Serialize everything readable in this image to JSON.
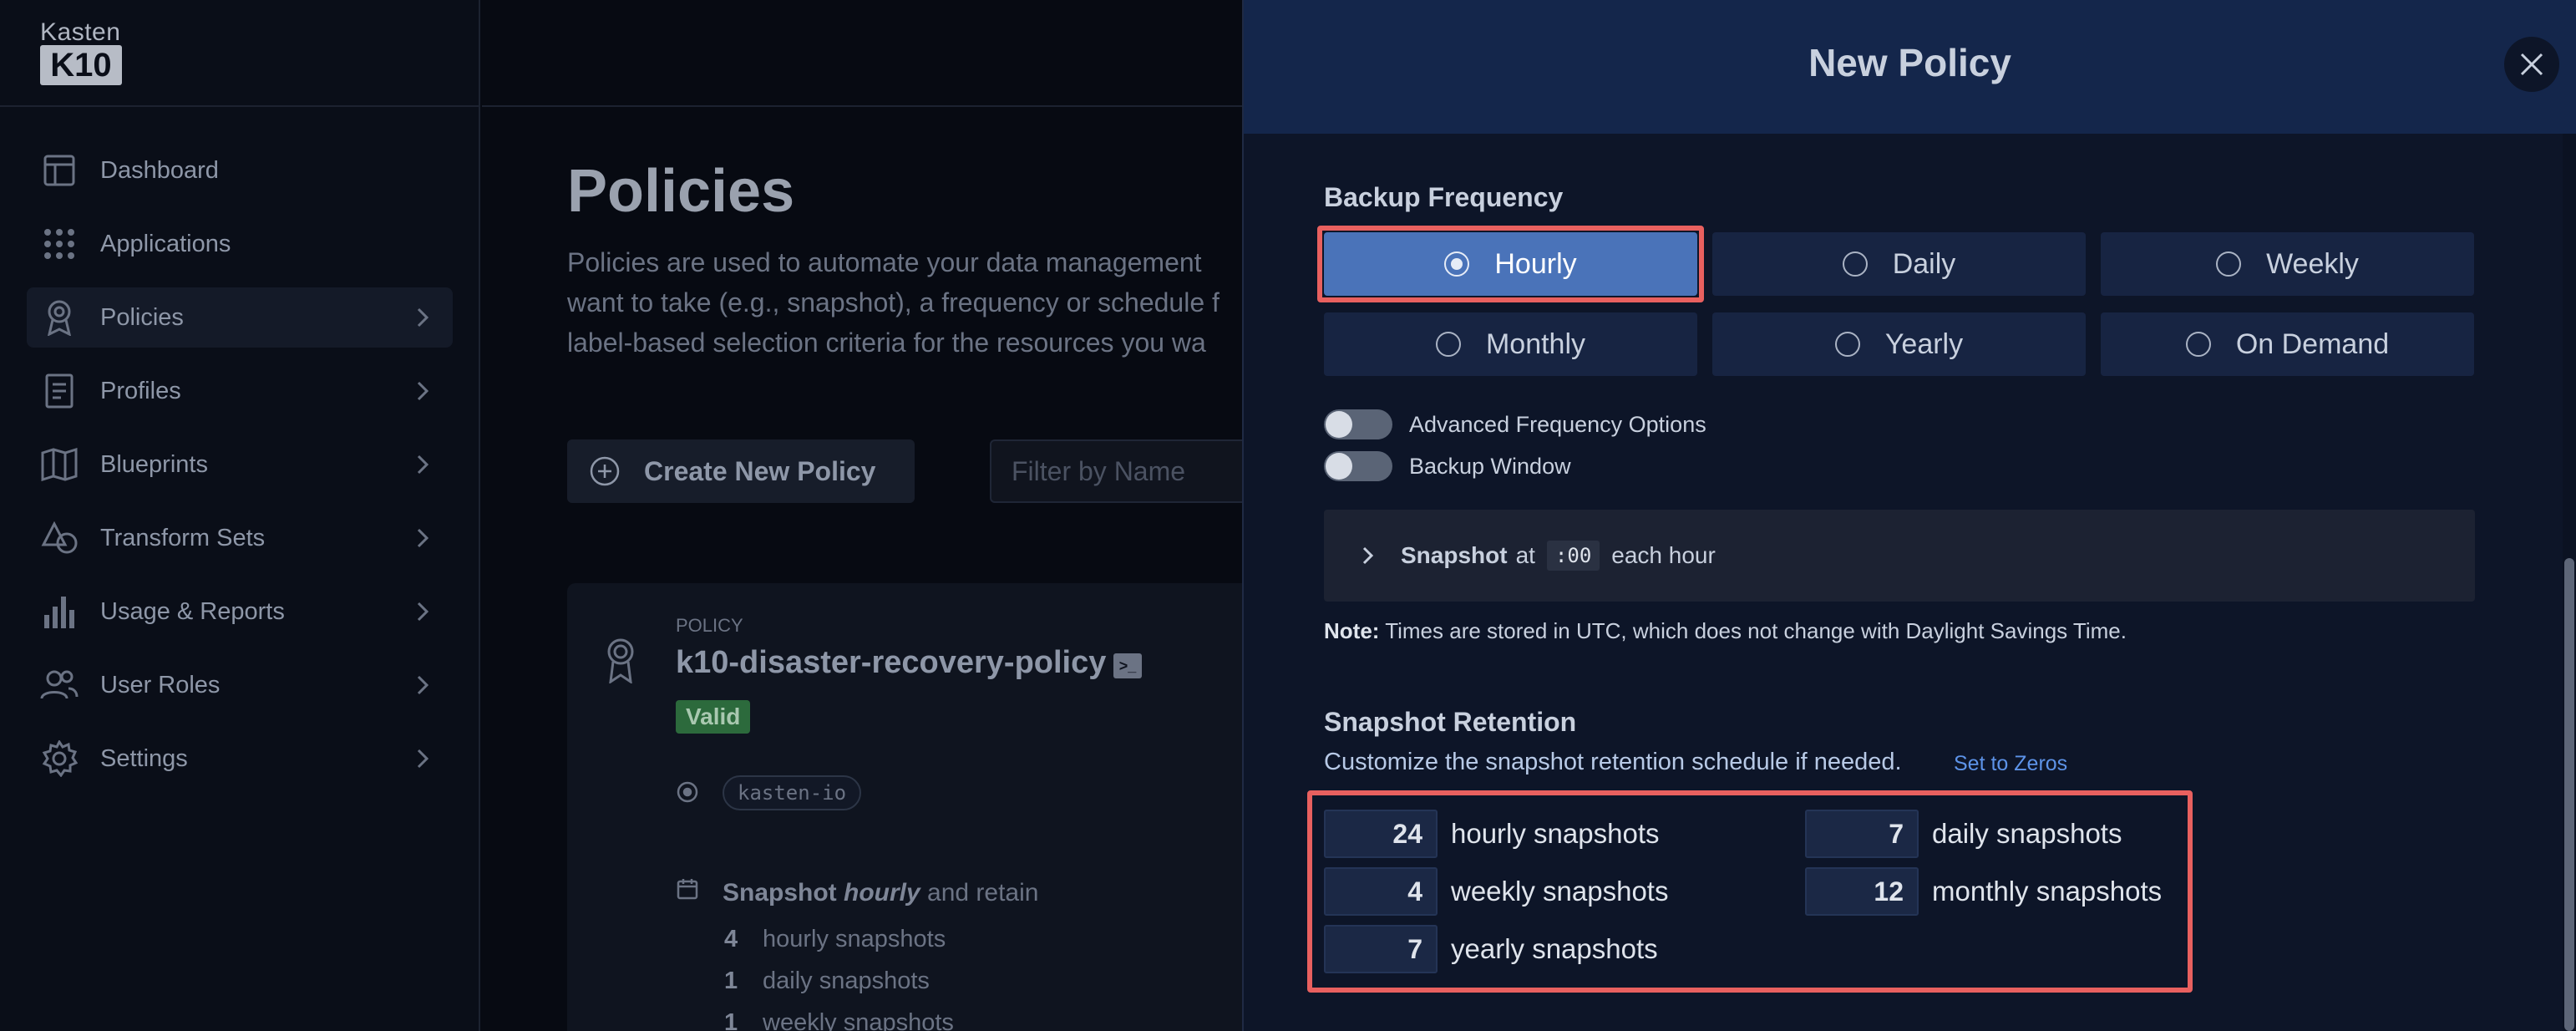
{
  "brand": {
    "top": "Kasten",
    "mark": "K10"
  },
  "sidebar": {
    "items": [
      {
        "label": "Dashboard",
        "icon": "dashboard-icon",
        "chevron": false
      },
      {
        "label": "Applications",
        "icon": "applications-grid-icon",
        "chevron": false
      },
      {
        "label": "Policies",
        "icon": "policy-award-icon",
        "chevron": true,
        "active": true
      },
      {
        "label": "Profiles",
        "icon": "profile-document-icon",
        "chevron": true
      },
      {
        "label": "Blueprints",
        "icon": "blueprint-map-icon",
        "chevron": true
      },
      {
        "label": "Transform Sets",
        "icon": "transform-shapes-icon",
        "chevron": true
      },
      {
        "label": "Usage & Reports",
        "icon": "bar-chart-icon",
        "chevron": true
      },
      {
        "label": "User Roles",
        "icon": "users-icon",
        "chevron": true
      },
      {
        "label": "Settings",
        "icon": "gear-icon",
        "chevron": true
      }
    ]
  },
  "main": {
    "title": "Policies",
    "description": "Policies are used to automate your data management want to take (e.g., snapshot), a frequency or schedule f label-based selection criteria for the resources you wa",
    "create_button": "Create New Policy",
    "filter_placeholder": "Filter by Name",
    "policy_card": {
      "overline": "POLICY",
      "name": "k10-disaster-recovery-policy",
      "status": "Valid",
      "namespace": "kasten-io",
      "schedule_prefix": "Snapshot",
      "schedule_freq": "hourly",
      "schedule_suffix": "and retain",
      "retention": [
        {
          "count": "4",
          "label": "hourly snapshots"
        },
        {
          "count": "1",
          "label": "daily snapshots"
        },
        {
          "count": "1",
          "label": "weekly snapshots"
        }
      ]
    }
  },
  "modal": {
    "title": "New Policy",
    "backup_frequency_title": "Backup Frequency",
    "frequency_options": [
      "Hourly",
      "Daily",
      "Weekly",
      "Monthly",
      "Yearly",
      "On Demand"
    ],
    "selected_frequency": "Hourly",
    "advanced_frequency_label": "Advanced Frequency Options",
    "backup_window_label": "Backup Window",
    "snapshot_summary": {
      "bold": "Snapshot",
      "at": "at",
      "time": ":00",
      "suffix": "each hour"
    },
    "note_label": "Note:",
    "note_text": "Times are stored in UTC, which does not change with Daylight Savings Time.",
    "retention_title": "Snapshot Retention",
    "retention_desc": "Customize the snapshot retention schedule if needed.",
    "set_zeros": "Set to Zeros",
    "retention": {
      "hourly": {
        "value": "24",
        "label": "hourly snapshots"
      },
      "daily": {
        "value": "7",
        "label": "daily snapshots"
      },
      "weekly": {
        "value": "4",
        "label": "weekly snapshots"
      },
      "monthly": {
        "value": "12",
        "label": "monthly snapshots"
      },
      "yearly": {
        "value": "7",
        "label": "yearly snapshots"
      }
    },
    "highlight_color": "#e8605f",
    "selected_color": "#4a73b9"
  }
}
